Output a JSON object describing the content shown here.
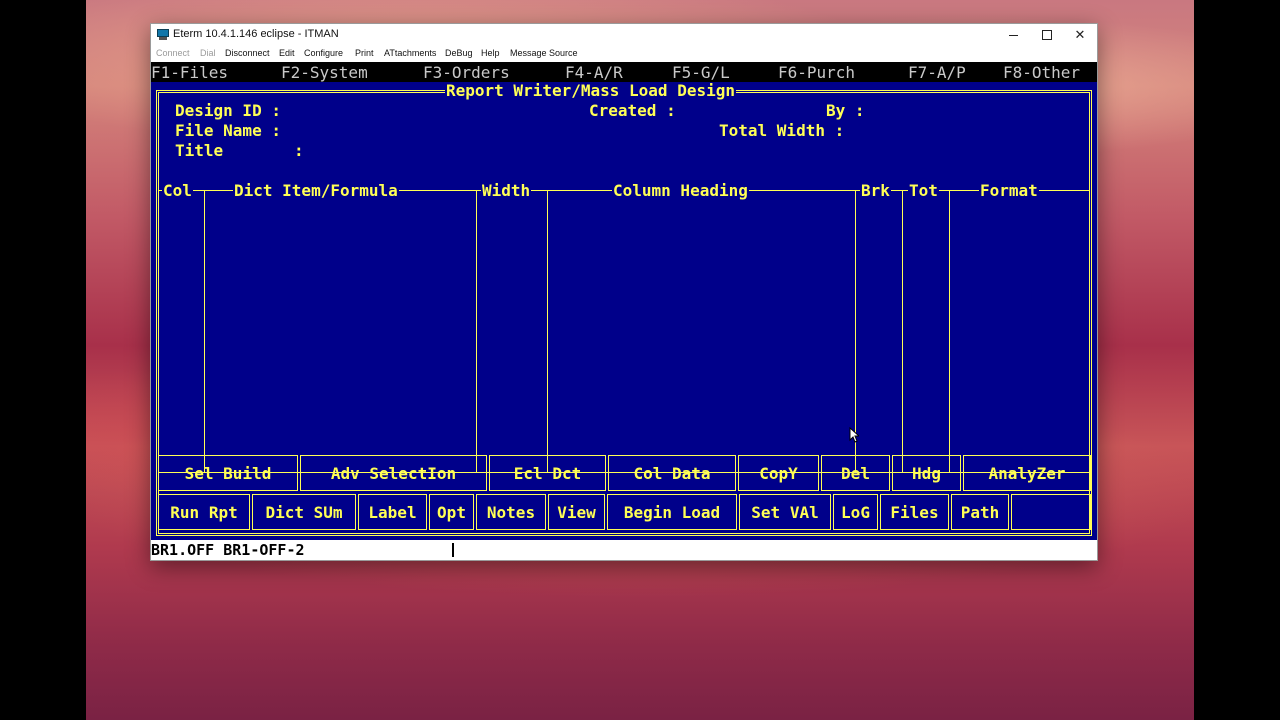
{
  "window": {
    "title": "Eterm 10.4.1.146 eclipse - ITMAN",
    "icon": "terminal-app-icon"
  },
  "menu": [
    {
      "label": "Connect",
      "disabled": true
    },
    {
      "label": "Dial",
      "disabled": true
    },
    {
      "label": "Disconnect",
      "disabled": false
    },
    {
      "label": "Edit",
      "disabled": false
    },
    {
      "label": "Configure",
      "disabled": false
    },
    {
      "label": "Print",
      "disabled": false
    },
    {
      "label": "ATtachments",
      "disabled": false
    },
    {
      "label": "DeBug",
      "disabled": false
    },
    {
      "label": "Help",
      "disabled": false
    },
    {
      "label": "Message Source",
      "disabled": false
    }
  ],
  "fkeys": [
    "F1-Files",
    "F2-System",
    "F3-Orders",
    "F4-A/R",
    "F5-G/L",
    "F6-Purch",
    "F7-A/P",
    "F8-Other"
  ],
  "screen": {
    "title": "Report Writer/Mass Load Design",
    "fields": {
      "design_id": "Design ID :",
      "created": "Created :",
      "by": "By :",
      "file_name": "File Name :",
      "total_width": "Total Width :",
      "title_label": "Title",
      "title_colon": ":"
    },
    "columns": [
      "Col",
      "Dict Item/Formula",
      "Width",
      "Column Heading",
      "Brk",
      "Tot",
      "Format"
    ]
  },
  "buttons_row1": [
    "Sel Build",
    "Adv SelectIon",
    "Ecl Dct",
    "Col Data",
    "CopY",
    "Del",
    "Hdg",
    "AnalyZer"
  ],
  "buttons_row2": [
    "Run Rpt",
    "Dict SUm",
    "Label",
    "Opt",
    "Notes",
    "View",
    "Begin Load",
    "Set VAl",
    "LoG",
    "Files",
    "Path",
    ""
  ],
  "status": {
    "text": "BR1.OFF BR1-OFF-2"
  },
  "colors": {
    "terminal_bg": "#00008a",
    "terminal_fg": "#ffff55",
    "fkey_fg": "#c9c9c9"
  }
}
